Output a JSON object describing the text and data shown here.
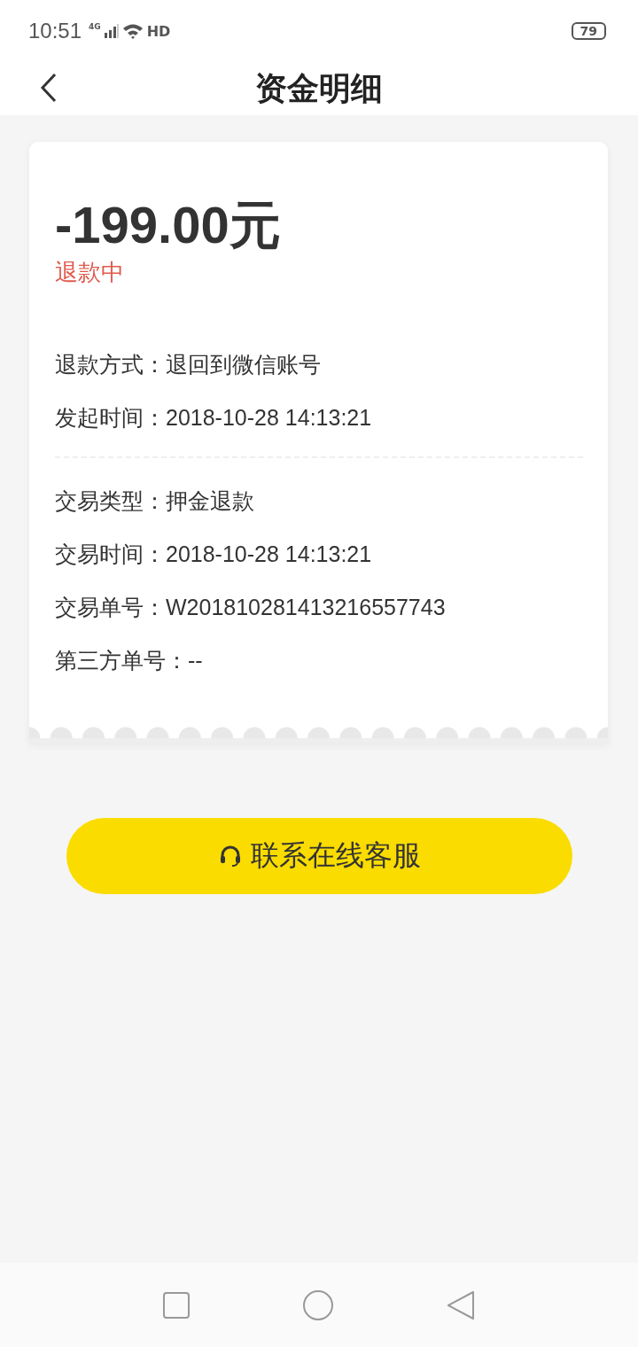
{
  "status_bar": {
    "time": "10:51",
    "network": "4G",
    "hd": "HD",
    "battery": "79"
  },
  "header": {
    "title": "资金明细"
  },
  "detail": {
    "amount": "-199.00元",
    "status": "退款中",
    "sections": [
      [
        {
          "label": "退款方式：",
          "value": "退回到微信账号"
        },
        {
          "label": "发起时间：",
          "value": "2018-10-28 14:13:21"
        }
      ],
      [
        {
          "label": "交易类型：",
          "value": "押金退款"
        },
        {
          "label": "交易时间：",
          "value": "2018-10-28 14:13:21"
        },
        {
          "label": "交易单号：",
          "value": "W201810281413216557743"
        },
        {
          "label": "第三方单号：",
          "value": "--"
        }
      ]
    ]
  },
  "contact_button": {
    "label": "联系在线客服"
  }
}
